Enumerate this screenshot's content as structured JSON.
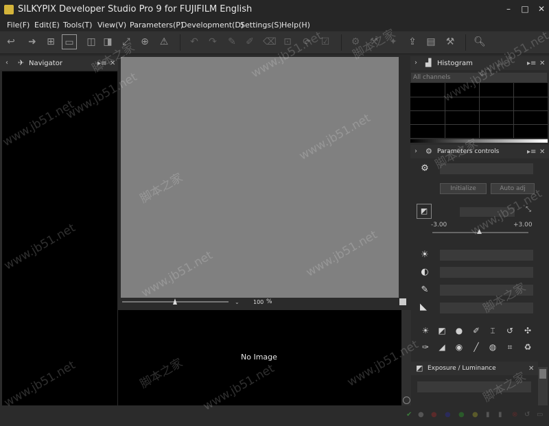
{
  "window": {
    "title": "SILKYPIX Developer Studio Pro 9 for FUJIFILM English",
    "minimize": "–",
    "maximize": "□",
    "close": "✕"
  },
  "menu": [
    "File(F)",
    "Edit(E)",
    "Tools(T)",
    "View(V)",
    "Parameters(P)",
    "Development(D)",
    "Settings(S)",
    "Help(H)"
  ],
  "navigator": {
    "title": "Navigator",
    "collapse": "‹",
    "pin": "▸≡",
    "close": "✕"
  },
  "preview": {
    "zoom_value": "100",
    "zoom_unit": "%"
  },
  "filmstrip": {
    "empty_text": "No Image"
  },
  "histogram": {
    "title": "Histogram",
    "channel": "All channels",
    "expand": "›",
    "pin": "▸≡",
    "close": "✕"
  },
  "parameters": {
    "title": "Parameters controls",
    "initialize": "Initialize",
    "auto_adjust": "Auto adj",
    "ev_min": "-3.00",
    "ev_max": "+3.00",
    "expand": "›",
    "pin": "▸≡",
    "close": "✕"
  },
  "exposure": {
    "title": "Exposure / Luminance",
    "close": "✕"
  },
  "watermark": [
    "www.jb51.net",
    "脚本之家"
  ]
}
